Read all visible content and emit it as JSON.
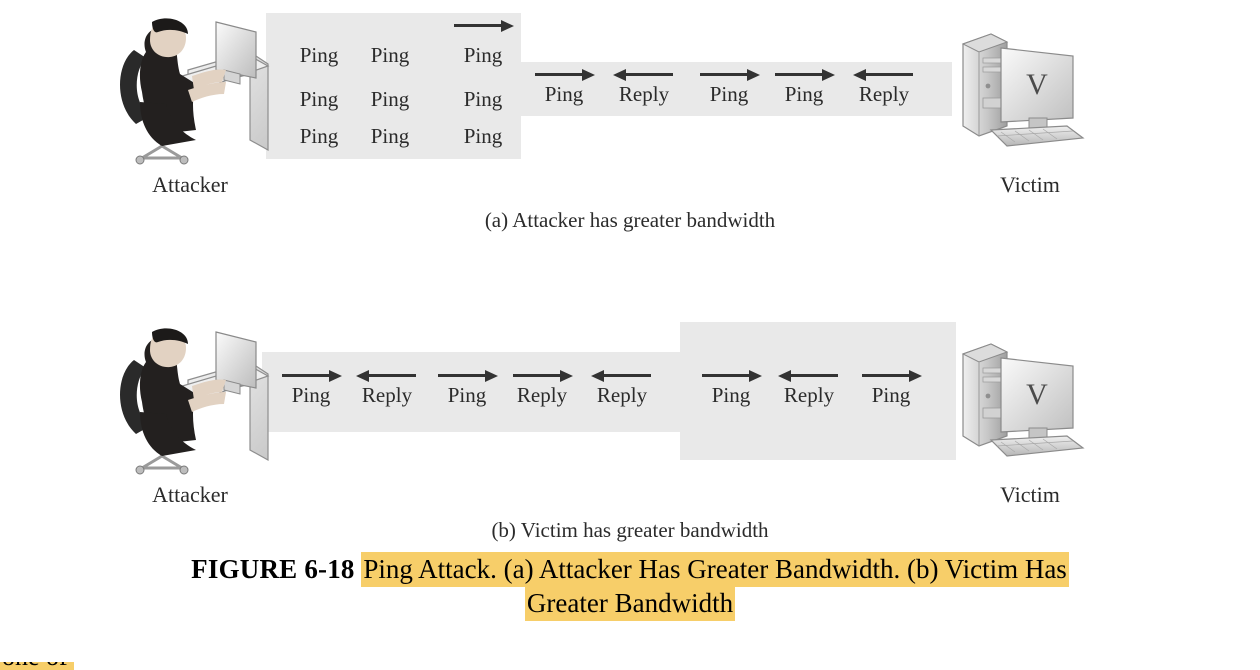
{
  "figure": {
    "label": "FIGURE 6-18",
    "caption_line1": "Ping Attack. (a) Attacker Has Greater Bandwidth. (b) Victim Has",
    "caption_line2": "Greater Bandwidth",
    "highlight_color": "#f7ce69",
    "band_color": "#e9e9e9",
    "bottom_partial_text": "one of"
  },
  "endpoints": {
    "attacker_label": "Attacker",
    "victim_label": "Victim",
    "victim_monitor_glyph": "V"
  },
  "diagram_a": {
    "subcaption": "(a) Attacker has greater bandwidth",
    "flood_grid": [
      [
        "Ping",
        "Ping",
        "Ping"
      ],
      [
        "Ping",
        "Ping",
        "Ping"
      ],
      [
        "Ping",
        "Ping",
        "Ping"
      ]
    ],
    "flood_arrow_direction": "right",
    "link_tokens": [
      {
        "label": "Ping",
        "direction": "right"
      },
      {
        "label": "Reply",
        "direction": "left"
      },
      {
        "label": "Ping",
        "direction": "right"
      },
      {
        "label": "Ping",
        "direction": "right"
      },
      {
        "label": "Reply",
        "direction": "left"
      }
    ]
  },
  "diagram_b": {
    "subcaption": "(b) Victim has greater bandwidth",
    "left_tokens": [
      {
        "label": "Ping",
        "direction": "right"
      },
      {
        "label": "Reply",
        "direction": "left"
      },
      {
        "label": "Ping",
        "direction": "right"
      },
      {
        "label": "Reply",
        "direction": "right"
      },
      {
        "label": "Reply",
        "direction": "left"
      }
    ],
    "right_tokens": [
      {
        "label": "Ping",
        "direction": "right"
      },
      {
        "label": "Reply",
        "direction": "left"
      },
      {
        "label": "Ping",
        "direction": "right"
      }
    ]
  }
}
